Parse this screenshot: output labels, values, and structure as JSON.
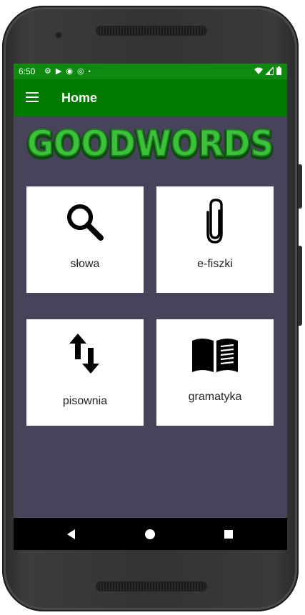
{
  "status_bar": {
    "time": "6:50",
    "left_icons": [
      "settings-icon",
      "play-store-icon",
      "shield-icon",
      "at-icon",
      "dot-icon"
    ],
    "right_icons": [
      "wifi-icon",
      "signal-icon",
      "battery-icon"
    ]
  },
  "app_bar": {
    "title": "Home",
    "menu_icon": "hamburger-menu-icon",
    "background": "#007a00"
  },
  "logo": {
    "text": "GOODWORDS",
    "color": "#35b52a"
  },
  "tiles": [
    {
      "label": "słowa",
      "icon": "search-icon"
    },
    {
      "label": "e-fiszki",
      "icon": "paperclip-icon"
    },
    {
      "label": "pisownia",
      "icon": "swap-vertical-icon"
    },
    {
      "label": "gramatyka",
      "icon": "book-icon"
    }
  ],
  "nav_bar": {
    "buttons": [
      "back-icon",
      "home-icon",
      "recents-icon"
    ]
  },
  "colors": {
    "screen_background": "#47435a",
    "status_bar": "#0f8a0f",
    "tile_background": "#ffffff"
  }
}
